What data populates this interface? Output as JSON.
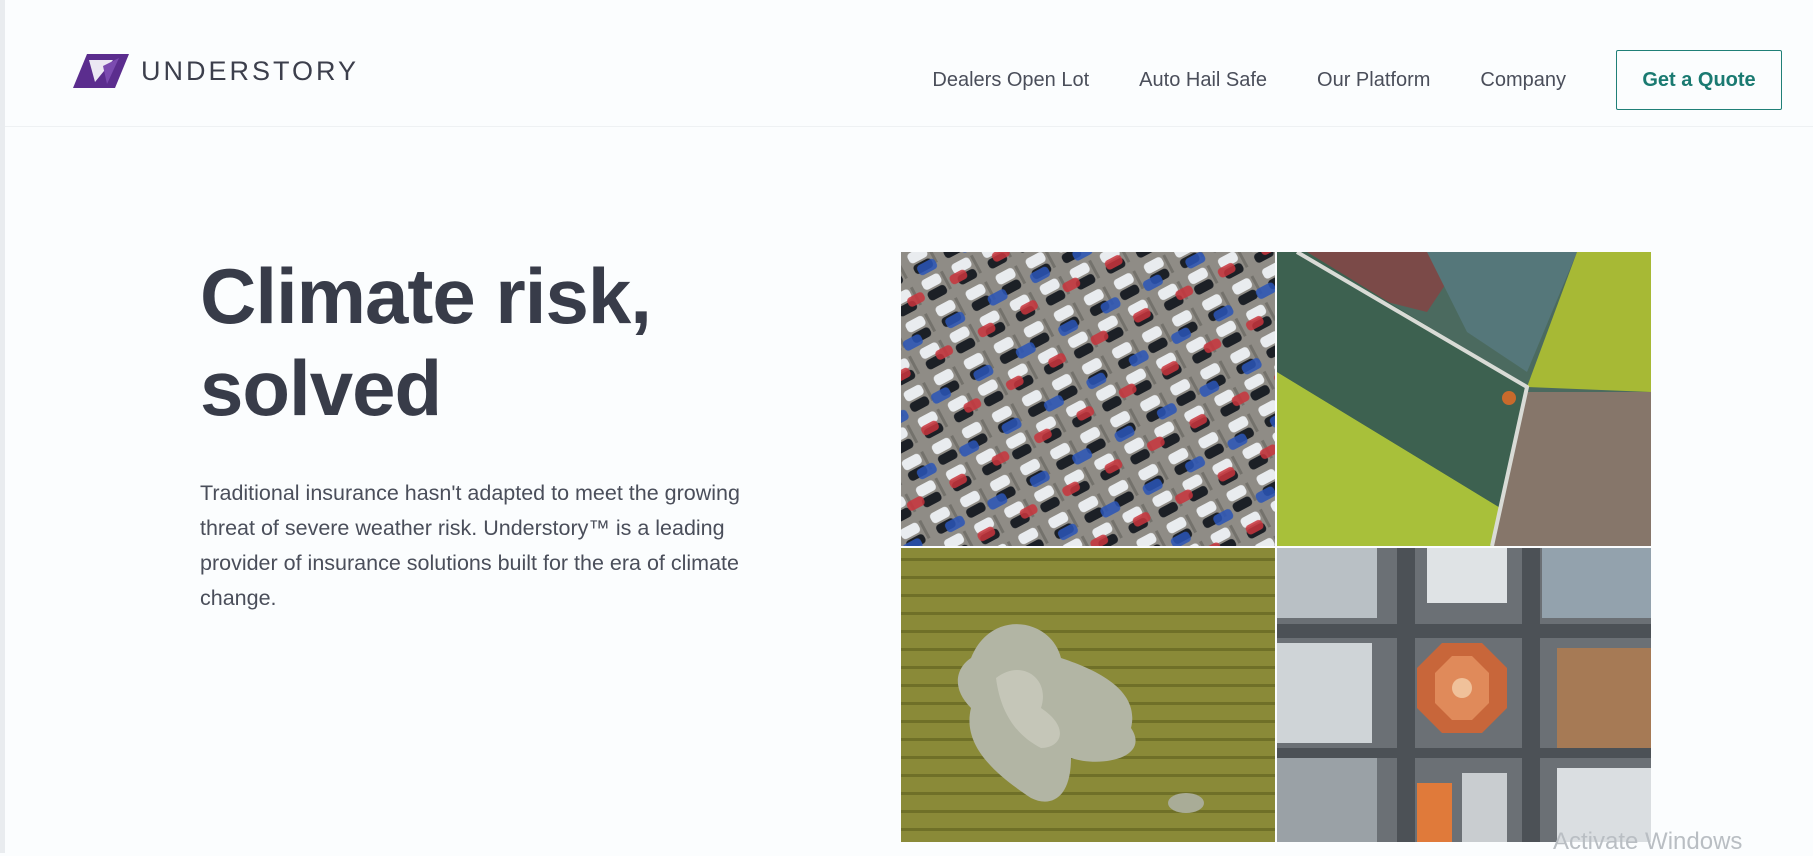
{
  "brand": {
    "name": "UNDERSTORY",
    "logo_color": "#5b2d8e"
  },
  "nav": {
    "links": [
      "Dealers Open Lot",
      "Auto Hail Safe",
      "Our Platform",
      "Company"
    ],
    "cta": "Get a Quote",
    "cta_color": "#1a7a71"
  },
  "hero": {
    "title_line1": "Climate risk,",
    "title_line2": "solved",
    "description": "Traditional insurance hasn't adapted to meet the growing threat of severe weather risk. Understory™ is a leading provider of insurance solutions built for the era of climate change."
  },
  "images": [
    {
      "icon": "parking-lot-aerial-image"
    },
    {
      "icon": "farm-fields-aerial-image"
    },
    {
      "icon": "crop-damage-aerial-image"
    },
    {
      "icon": "city-intersection-aerial-image"
    }
  ],
  "watermark": "Activate Windows"
}
